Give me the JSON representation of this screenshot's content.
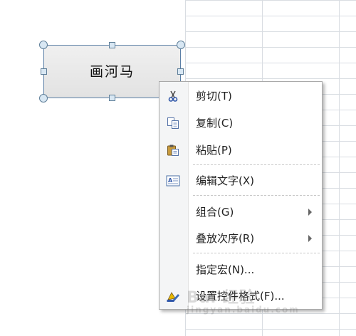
{
  "shape": {
    "label": "画河马"
  },
  "context_menu": {
    "items": [
      {
        "label": "剪切(T)",
        "icon": "scissors-icon",
        "submenu": false
      },
      {
        "label": "复制(C)",
        "icon": "copy-icon",
        "submenu": false
      },
      {
        "label": "粘贴(P)",
        "icon": "paste-icon",
        "submenu": false
      },
      {
        "label": "编辑文字(X)",
        "icon": "edit-text-icon",
        "submenu": false
      },
      {
        "label": "组合(G)",
        "icon": "",
        "submenu": true
      },
      {
        "label": "叠放次序(R)",
        "icon": "",
        "submenu": true
      },
      {
        "label": "指定宏(N)...",
        "icon": "",
        "submenu": false
      },
      {
        "label": "设置控件格式(F)...",
        "icon": "format-control-icon",
        "submenu": false
      }
    ]
  },
  "watermark": {
    "text": "Bai 经验",
    "sub": "jingyan.baidu.com"
  },
  "colors": {
    "selection_border": "#5b7fa6",
    "menu_gutter": "#f4f5f6",
    "grid": "#d9dde2"
  }
}
